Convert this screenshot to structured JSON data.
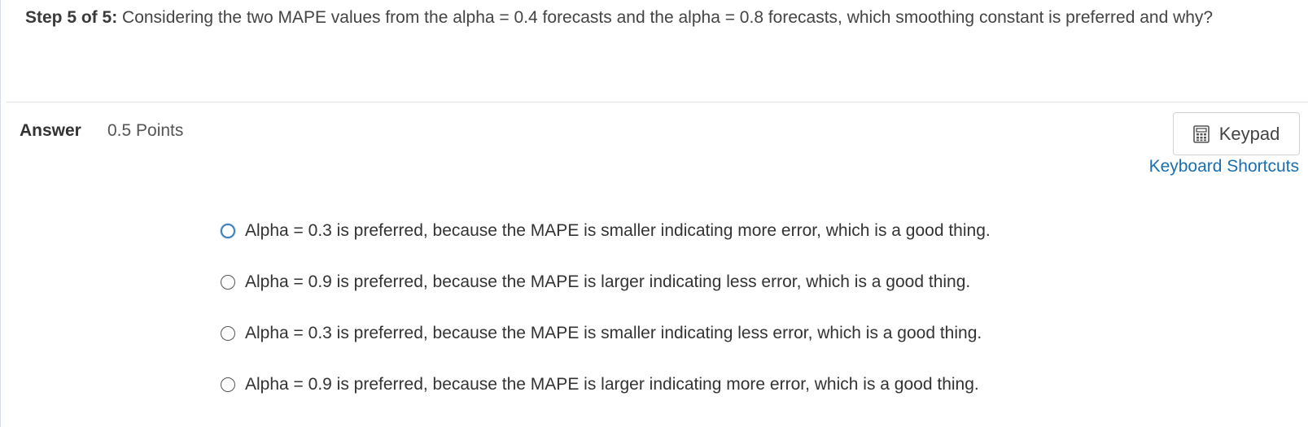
{
  "question": {
    "step_label": "Step 5 of 5:",
    "text": " Considering the two MAPE values from the alpha = 0.4 forecasts and the alpha = 0.8 forecasts, which smoothing constant is preferred and why?"
  },
  "answer": {
    "label": "Answer",
    "points": "0.5 Points"
  },
  "toolbar": {
    "keypad_label": "Keypad",
    "keypad_icon": "calculator-icon",
    "shortcuts_label": "Keyboard Shortcuts"
  },
  "options": [
    {
      "label": "Alpha = 0.3 is preferred, because the MAPE is smaller indicating more error, which is a good thing."
    },
    {
      "label": "Alpha = 0.9 is preferred, because the MAPE is larger indicating less error, which is a good thing."
    },
    {
      "label": "Alpha = 0.3 is preferred, because the MAPE is smaller indicating less error, which is a good thing."
    },
    {
      "label": "Alpha = 0.9 is preferred, because the MAPE is larger indicating more error, which is a good thing."
    }
  ],
  "colors": {
    "link": "#1a6fb0",
    "focus_ring": "#3b82b8",
    "text": "#333333"
  }
}
